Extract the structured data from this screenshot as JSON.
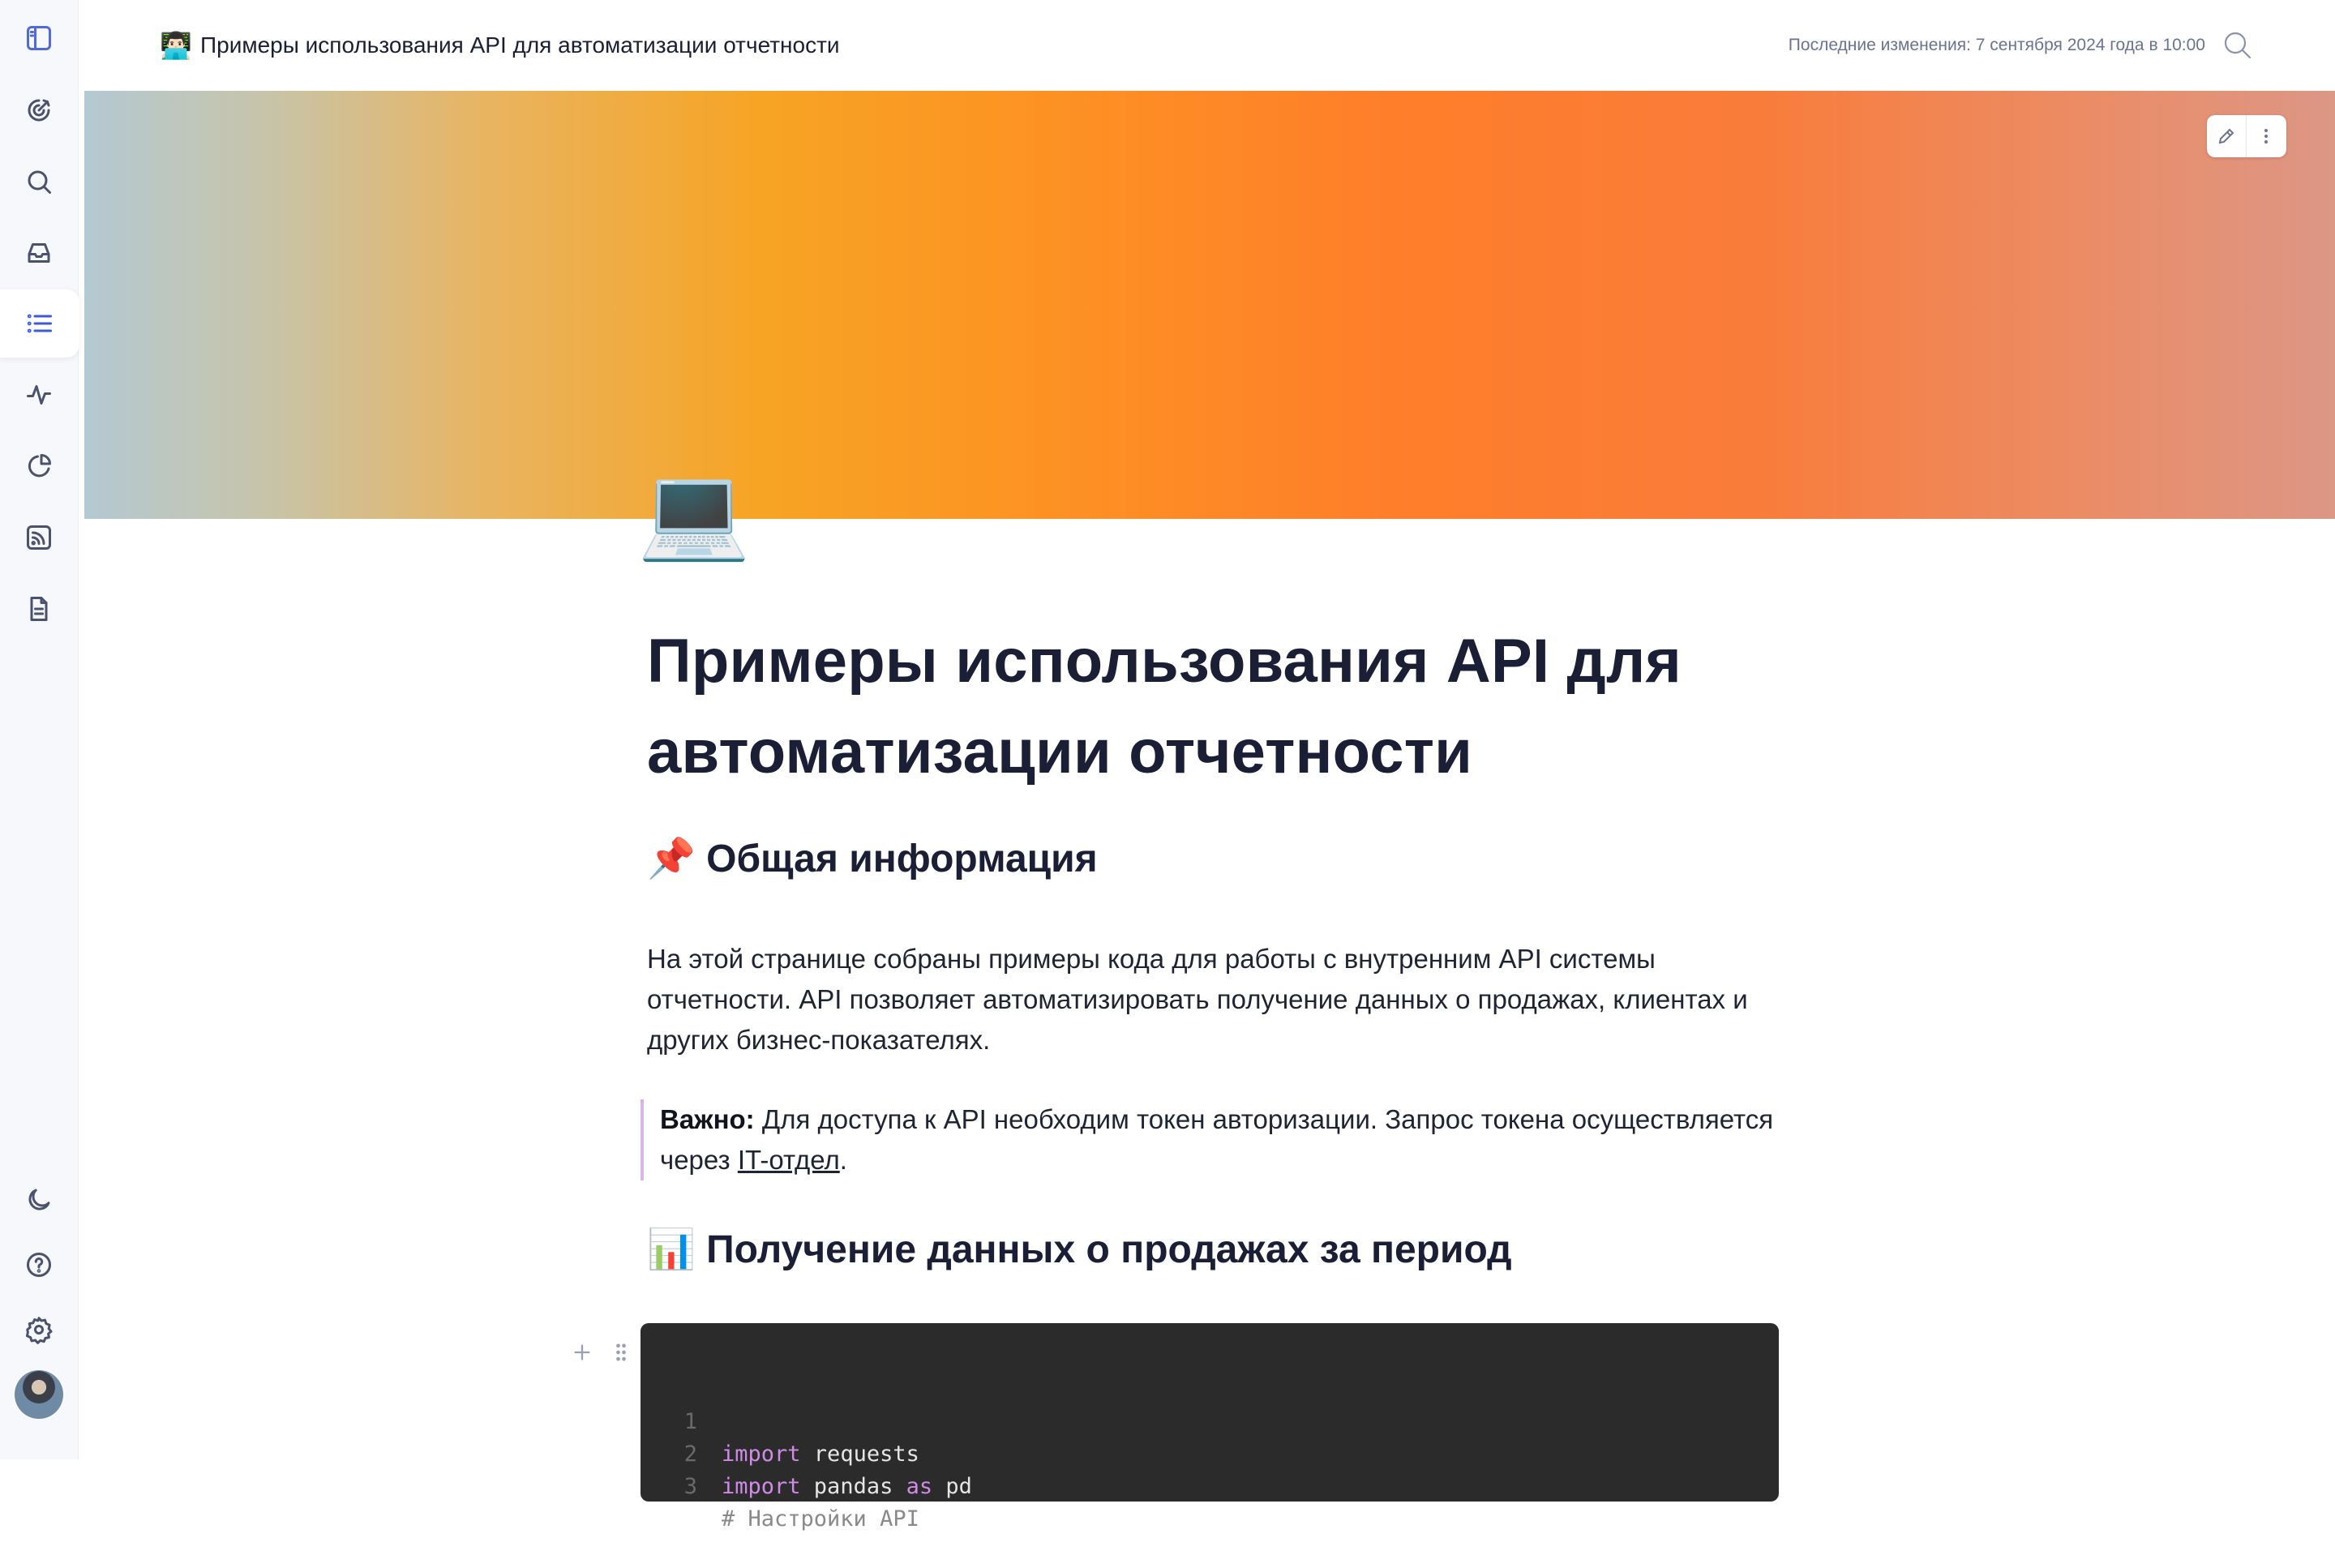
{
  "header": {
    "emoji": "👨🏻‍💻",
    "title": "Примеры использования API для автоматизации отчетности",
    "last_modified": "Последние изменения: 7 сентября 2024 года в 10:00"
  },
  "sidebar": {
    "top_icons": [
      "panel-icon",
      "target-icon",
      "search-icon",
      "inbox-icon",
      "list-icon",
      "activity-icon",
      "pie-chart-icon",
      "rss-icon",
      "document-icon"
    ],
    "bottom_icons": [
      "moon-icon",
      "help-icon",
      "gear-icon"
    ],
    "active_index": 4
  },
  "page": {
    "icon": "💻",
    "title": "Примеры использования API для автоматизации отчетности",
    "section1": {
      "emoji": "📌",
      "heading": "Общая информация",
      "paragraph": "На этой странице собраны примеры кода для работы с внутренним API системы отчетности. API позволяет автоматизировать получение данных о продажах, клиентах и других бизнес-показателях."
    },
    "callout": {
      "bold": "Важно:",
      "text_before_link": " Для доступа к API необходим токен авторизации. Запрос токена осуществляется через ",
      "link": "IT-отдел",
      "text_after_link": "."
    },
    "section2": {
      "emoji": "📊",
      "heading": "Получение данных о продажах за период"
    },
    "code": {
      "lines": [
        {
          "n": "1",
          "kw1": "import",
          "rest1": " requests",
          "kw2": "",
          "rest2": ""
        },
        {
          "n": "2",
          "kw1": "import",
          "rest1": " pandas ",
          "kw2": "as",
          "rest2": " pd"
        },
        {
          "n": "3",
          "comment": "# Настройки API"
        }
      ]
    }
  },
  "colors": {
    "accent": "#3d5bd6",
    "callout_border": "#d7b6ec",
    "code_bg": "#2b2b2b",
    "keyword": "#d08be6"
  }
}
